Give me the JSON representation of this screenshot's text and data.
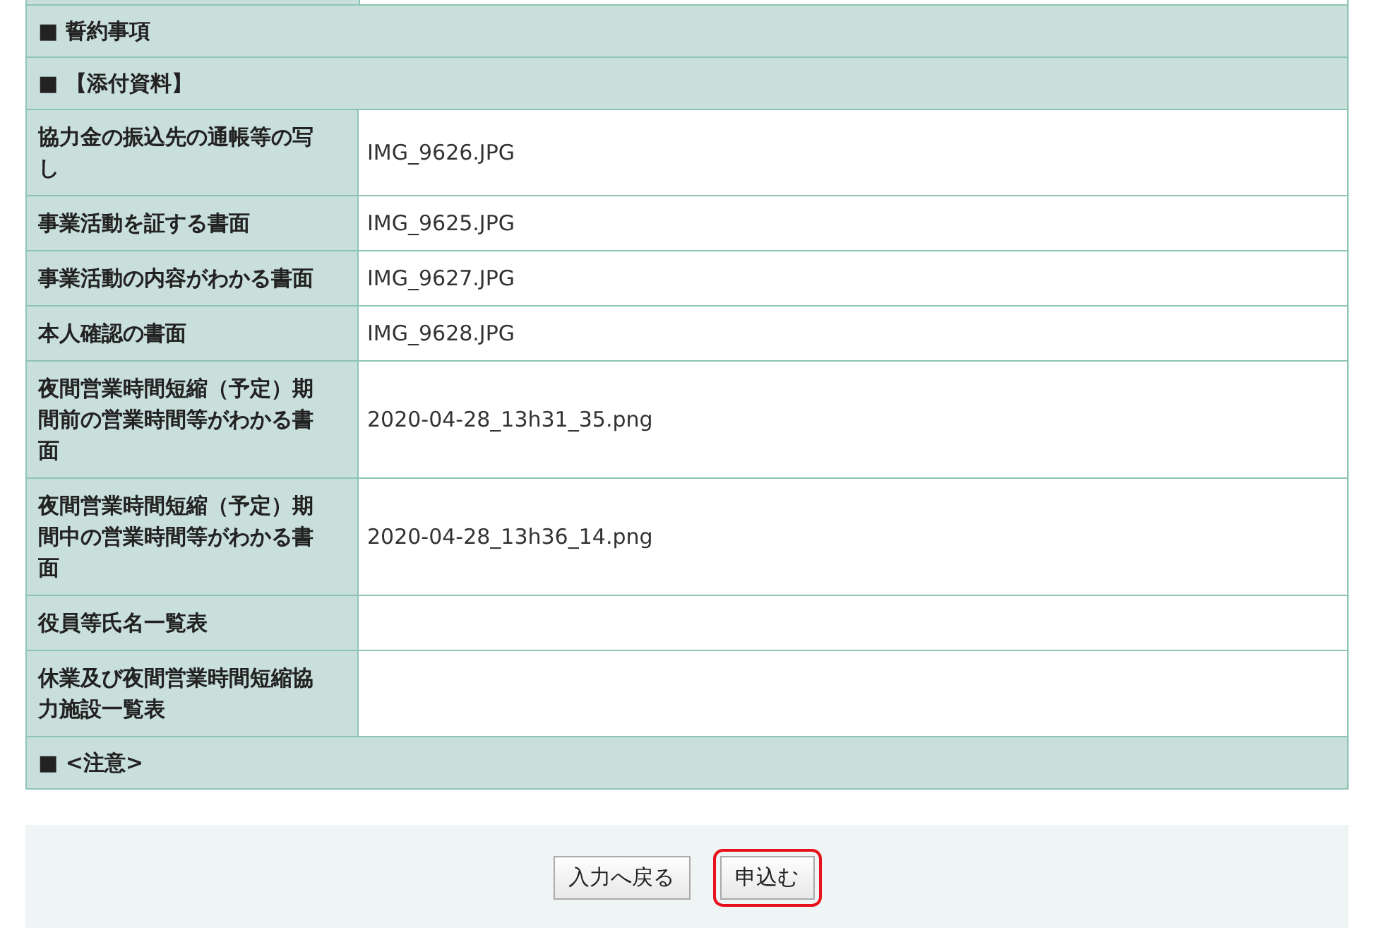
{
  "sections_top": [
    {
      "heading": "■ 誓約事項"
    },
    {
      "heading": "■ 【添付資料】"
    }
  ],
  "attachments": [
    {
      "label": "協力金の振込先の通帳等の写し",
      "file": "IMG_9626.JPG"
    },
    {
      "label": "事業活動を証する書面",
      "file": "IMG_9625.JPG"
    },
    {
      "label": "事業活動の内容がわかる書面",
      "file": "IMG_9627.JPG"
    },
    {
      "label": "本人確認の書面",
      "file": "IMG_9628.JPG"
    },
    {
      "label": "夜間営業時間短縮（予定）期間前の営業時間等がわかる書面",
      "file": "2020-04-28_13h31_35.png"
    },
    {
      "label": "夜間営業時間短縮（予定）期間中の営業時間等がわかる書面",
      "file": "2020-04-28_13h36_14.png"
    },
    {
      "label": "役員等氏名一覧表"
    },
    {
      "label": "休業及び夜間営業時間短縮協力施設一覧表"
    }
  ],
  "sections_bottom": [
    {
      "heading": "■ <注意>"
    }
  ],
  "buttons": [
    {
      "label": "入力へ戻る",
      "highlighted": false
    },
    {
      "label": "申込む",
      "highlighted": true
    }
  ]
}
